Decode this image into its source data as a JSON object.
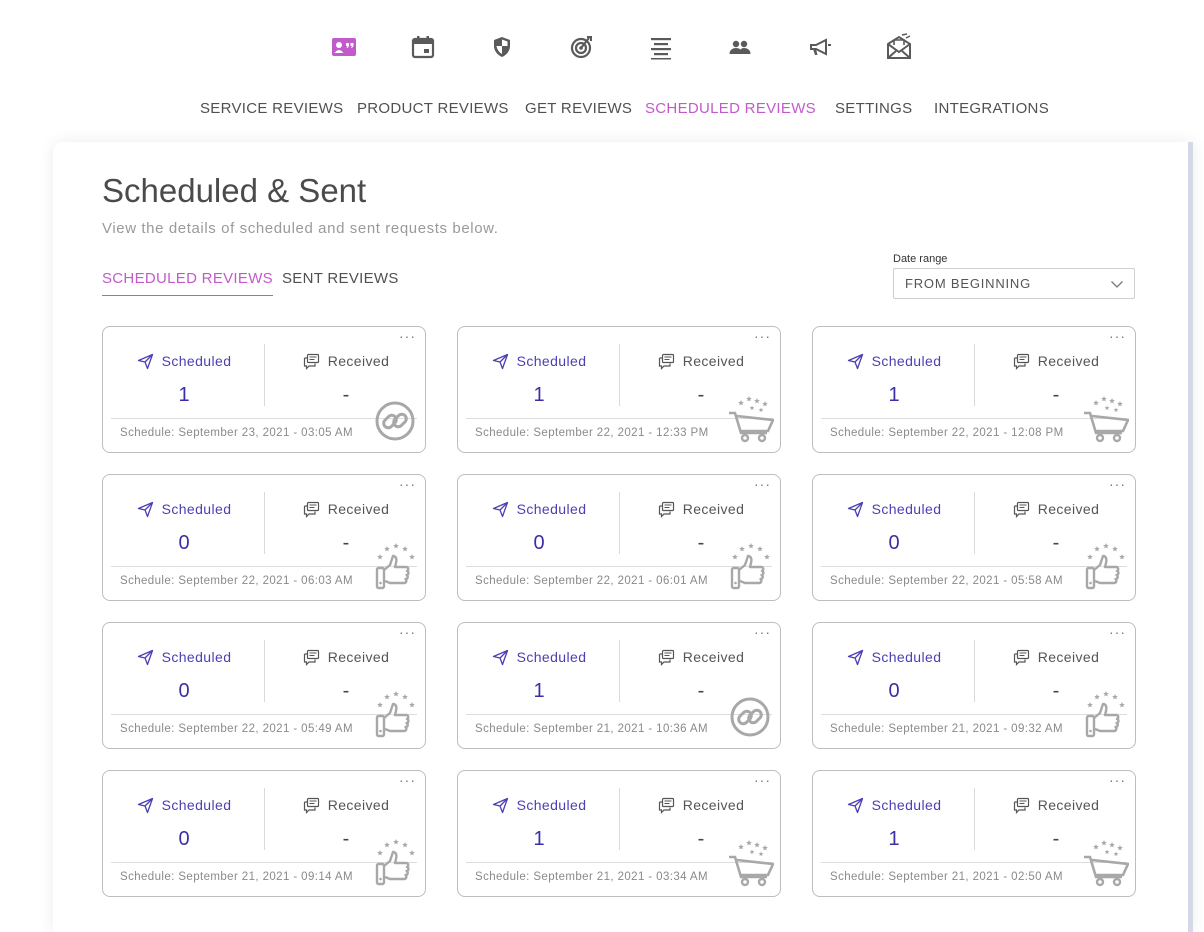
{
  "icons": {
    "top_bar": [
      "reviews-icon",
      "calendar-icon",
      "shield-icon",
      "target-icon",
      "align-icon",
      "people-icon",
      "megaphone-icon",
      "mail-icon"
    ],
    "active_color": "#c25acc",
    "inactive_color": "#5a5a5a"
  },
  "nav": {
    "items": [
      {
        "label": "SERVICE REVIEWS"
      },
      {
        "label": "PRODUCT REVIEWS"
      },
      {
        "label": "GET REVIEWS"
      },
      {
        "label": "SCHEDULED REVIEWS"
      },
      {
        "label": "SETTINGS"
      },
      {
        "label": "INTEGRATIONS"
      }
    ],
    "active_index": 3
  },
  "page": {
    "title": "Scheduled & Sent",
    "subtitle": "View the details of scheduled and sent requests below."
  },
  "subtabs": {
    "scheduled": "SCHEDULED REVIEWS",
    "sent": "SENT REVIEWS",
    "active": "scheduled"
  },
  "date_range": {
    "label": "Date range",
    "value": "FROM BEGINNING"
  },
  "card_labels": {
    "scheduled": "Scheduled",
    "received": "Received",
    "more": "···"
  },
  "cards": [
    {
      "scheduled": "1",
      "received": "-",
      "schedule": "Schedule: September 23, 2021 - 03:05 AM",
      "type": "link"
    },
    {
      "scheduled": "1",
      "received": "-",
      "schedule": "Schedule: September 22, 2021 - 12:33 PM",
      "type": "cart"
    },
    {
      "scheduled": "1",
      "received": "-",
      "schedule": "Schedule: September 22, 2021 - 12:08 PM",
      "type": "cart"
    },
    {
      "scheduled": "0",
      "received": "-",
      "schedule": "Schedule: September 22, 2021 - 06:03 AM",
      "type": "thumb"
    },
    {
      "scheduled": "0",
      "received": "-",
      "schedule": "Schedule: September 22, 2021 - 06:01 AM",
      "type": "thumb"
    },
    {
      "scheduled": "0",
      "received": "-",
      "schedule": "Schedule: September 22, 2021 - 05:58 AM",
      "type": "thumb"
    },
    {
      "scheduled": "0",
      "received": "-",
      "schedule": "Schedule: September 22, 2021 - 05:49 AM",
      "type": "thumb"
    },
    {
      "scheduled": "1",
      "received": "-",
      "schedule": "Schedule: September 21, 2021 - 10:36 AM",
      "type": "link"
    },
    {
      "scheduled": "0",
      "received": "-",
      "schedule": "Schedule: September 21, 2021 - 09:32 AM",
      "type": "thumb"
    },
    {
      "scheduled": "0",
      "received": "-",
      "schedule": "Schedule: September 21, 2021 - 09:14 AM",
      "type": "thumb"
    },
    {
      "scheduled": "1",
      "received": "-",
      "schedule": "Schedule: September 21, 2021 - 03:34 AM",
      "type": "cart"
    },
    {
      "scheduled": "1",
      "received": "-",
      "schedule": "Schedule: September 21, 2021 - 02:50 AM",
      "type": "cart"
    }
  ]
}
